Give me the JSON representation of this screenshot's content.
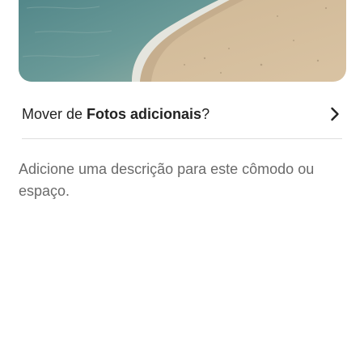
{
  "photo": {
    "subject": "beach-photo",
    "colors": {
      "water": "#5f8f92",
      "sand": "#d4bc98",
      "foam": "#e9ecea"
    }
  },
  "move": {
    "prefix": "Mover de ",
    "album": "Fotos adicionais",
    "suffix": "?"
  },
  "description": {
    "text": "Adicione uma descrição para este cômodo ou espaço."
  },
  "icons": {
    "move_chevron": "chevron-right-icon"
  }
}
